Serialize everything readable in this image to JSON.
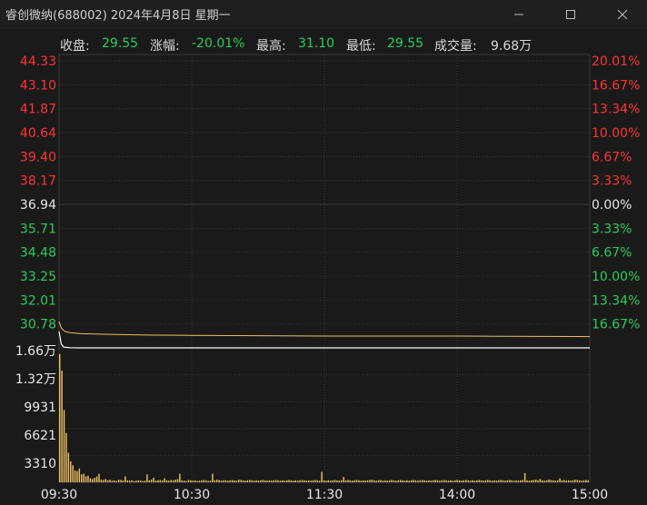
{
  "window": {
    "title": "睿创微纳(688002)  2024年4月8日  星期一",
    "minimize_icon": "minimize-icon",
    "maximize_icon": "maximize-icon",
    "close_icon": "close-icon"
  },
  "quote": {
    "close_label": "收盘:",
    "close_value": "29.55",
    "change_label": "涨幅:",
    "change_value": "-20.01%",
    "high_label": "最高:",
    "high_value": "31.10",
    "low_label": "最低:",
    "low_value": "29.55",
    "volume_label": "成交量:",
    "volume_value": "9.68万"
  },
  "colors": {
    "up": "#ff3333",
    "down": "#2ecc5c",
    "neutral": "#e6e6e6",
    "price_line": "#ffffff",
    "avg_line": "#f0c060",
    "volume_bar": "#f0c060",
    "grid": "#3a3a3a"
  },
  "chart_data": {
    "type": "line",
    "prev_close": 36.94,
    "price_axis": {
      "min": 29.55,
      "max": 44.33,
      "left_labels": [
        "44.33",
        "43.10",
        "41.87",
        "40.64",
        "39.40",
        "38.17",
        "36.94",
        "35.71",
        "34.48",
        "33.25",
        "32.01",
        "30.78"
      ],
      "right_labels": [
        "20.01%",
        "16.67%",
        "13.34%",
        "10.00%",
        "6.67%",
        "3.33%",
        "0.00%",
        "3.33%",
        "6.67%",
        "10.00%",
        "13.34%",
        "16.67%"
      ]
    },
    "volume_axis": {
      "max": 19900,
      "labels": [
        "1.66万",
        "1.32万",
        "9931",
        "6621",
        "3310"
      ]
    },
    "time_labels": [
      "09:30",
      "10:30",
      "11:30",
      "14:00",
      "15:00"
    ],
    "price": {
      "x": [
        0,
        1,
        2,
        3,
        5,
        10,
        30,
        60,
        120,
        180,
        240
      ],
      "y": [
        30.4,
        29.75,
        29.6,
        29.58,
        29.56,
        29.55,
        29.55,
        29.55,
        29.55,
        29.55,
        29.55
      ]
    },
    "average": {
      "x": [
        0,
        1,
        2,
        3,
        5,
        10,
        20,
        40,
        60,
        80,
        100,
        120,
        140,
        160,
        180,
        200,
        220,
        240
      ],
      "y": [
        30.9,
        30.58,
        30.45,
        30.38,
        30.33,
        30.28,
        30.25,
        30.21,
        30.19,
        30.18,
        30.17,
        30.16,
        30.16,
        30.16,
        30.16,
        30.15,
        30.14,
        30.13
      ]
    },
    "volume": {
      "values": [
        19500,
        17000,
        11000,
        7500,
        4500,
        3200,
        2600,
        1800,
        1700,
        2100,
        1200,
        1300,
        900,
        1000,
        600,
        500,
        700,
        900,
        1300,
        400,
        350,
        500,
        300,
        400,
        250,
        300,
        200,
        400,
        350,
        300,
        900,
        300,
        250,
        300,
        200,
        250,
        300,
        250,
        200,
        250,
        1200,
        300,
        400,
        700,
        250,
        300,
        350,
        250,
        600,
        300,
        250,
        350,
        300,
        400,
        500,
        1300,
        300,
        250,
        200,
        350,
        300,
        250,
        300,
        200,
        250,
        300,
        350,
        300,
        200,
        250,
        1300,
        300,
        400,
        350,
        250,
        300,
        300,
        250,
        300,
        350,
        300,
        250,
        400,
        350,
        300,
        250,
        300,
        350,
        300,
        250,
        300,
        250,
        300,
        350,
        300,
        250,
        300,
        250,
        300,
        350,
        300,
        250,
        300,
        250,
        300,
        350,
        300,
        250,
        300,
        250,
        300,
        350,
        300,
        250,
        300,
        250,
        300,
        350,
        300,
        250,
        1600,
        300,
        250,
        300,
        250,
        300,
        350,
        300,
        250,
        300,
        800,
        300,
        350,
        300,
        250,
        300,
        350,
        300,
        250,
        300,
        250,
        300,
        350,
        400,
        300,
        250,
        300,
        350,
        250,
        300,
        250,
        300,
        350,
        300,
        250,
        300,
        350,
        300,
        250,
        300,
        250,
        300,
        350,
        300,
        250,
        300,
        350,
        300,
        250,
        300,
        250,
        300,
        350,
        300,
        250,
        300,
        350,
        300,
        250,
        300,
        250,
        300,
        350,
        300,
        250,
        300,
        350,
        300,
        250,
        300,
        250,
        300,
        350,
        300,
        250,
        300,
        350,
        300,
        250,
        300,
        250,
        300,
        350,
        300,
        250,
        300,
        350,
        300,
        250,
        300,
        250,
        300,
        350,
        1400,
        300,
        250,
        300,
        350,
        400,
        300,
        500,
        300,
        250,
        300,
        400,
        350,
        300,
        250,
        300,
        600,
        300,
        350,
        250,
        300,
        250,
        300,
        400,
        350,
        300,
        250,
        300,
        350,
        300
      ]
    }
  }
}
